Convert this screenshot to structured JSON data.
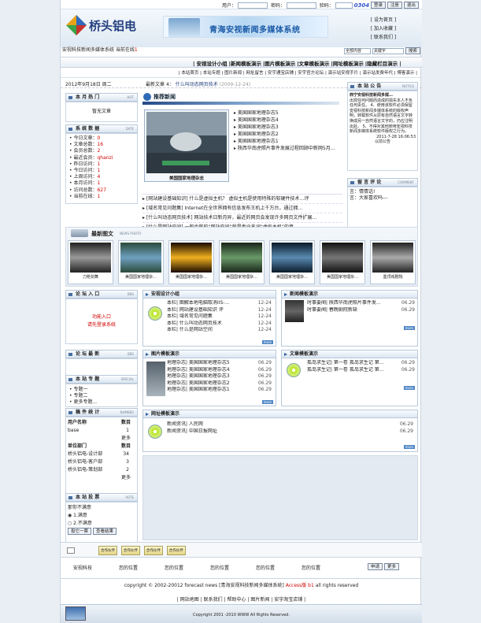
{
  "login": {
    "user_label": "用户：",
    "pass_label": "密码：",
    "code_label": "验码：",
    "code": "0304",
    "btn_login": "登录",
    "btn_register": "注册",
    "btn_logout": "退出"
  },
  "header": {
    "logo_text": "桥头铝电",
    "banner_text": "青海安视新闻多媒体系统",
    "quick": [
      "[ 设为首页 ]",
      "[ 加入收藏 ]",
      "[ 联系我们 ]"
    ],
    "subtitle": "安视科技新闻多媒体系统  当前在线",
    "online": "1"
  },
  "search": {
    "scope": "全部内容",
    "value": "关键字",
    "button": "搜索"
  },
  "nav": [
    "安视设计小组",
    "新闻模板演示",
    "图片模板演示",
    "文章模板演示",
    "网址模板演示",
    "隐藏栏目演示"
  ],
  "nav2": [
    "本站首页",
    "本站专题",
    "图片新闻",
    "网址留言",
    "安宇通宝店铺",
    "安宇官方论坛",
    "演示站安视手片",
    "演示站发费年代",
    "博客演示"
  ],
  "datebar": {
    "date": "2012年9月18日 周二",
    "hot_label": "最新文章",
    "hot_count": "4：",
    "hot_title": "什么叫动态网页技术",
    "hot_date": "(2009-12-24)"
  },
  "month_hot": {
    "title": "本 月 热 门",
    "tag": "HOT",
    "empty": "暂无文章"
  },
  "stats": {
    "title": "系 统 数 据",
    "tag": "DATE",
    "items": [
      {
        "label": "今日文章：",
        "value": "0"
      },
      {
        "label": "文章总数：",
        "value": "16"
      },
      {
        "label": "会员总数：",
        "value": "2"
      },
      {
        "label": "最近会员：",
        "value": "qhanzi"
      },
      {
        "label": "昨日访问：",
        "value": "1"
      },
      {
        "label": "今日访问：",
        "value": "1"
      },
      {
        "label": "上周访问：",
        "value": "4"
      },
      {
        "label": "本月访问：",
        "value": "1"
      },
      {
        "label": "访问总数：",
        "value": "627"
      },
      {
        "label": "当前在线：",
        "value": "1"
      }
    ]
  },
  "recommend": {
    "title": "推荐新闻",
    "caption": "美国国家地理杂志",
    "items": [
      "美国国家地理杂志5",
      "美国国家地理杂志4",
      "美国国家地理杂志3",
      "美国国家地理杂志2",
      "美国国家地理杂志1",
      "陕西华南虎照片事件发展过程回顾中新网5月…"
    ]
  },
  "news_lines": [
    "[网站建设基础知识] 什么是虚拟主机？ 虚拟主机是使用特殊的软硬件技术…评",
    "[域名常见问题集] Internet在全世界拥有信息发布王机上千万台，通过拥…",
    "[什么叫动态网页技术] 网站技术日新月异，最近的网页会发现许多网页文件扩展…",
    "[什么是网站空间] 一般也称的“网站空间”就是专业名词“虚拟主机”的意…"
  ],
  "notice": {
    "title": "本 站 公 告",
    "tag": "NOTICE",
    "heading": "西宁安视科技新闻多媒…",
    "body": "出现任何问题而造成的损失本人不负任何责任。 4、使用该软件必须保留安视科技新闻多媒体系统的版权声明，转载软件从原有自然语言文字转换成另一自然语言文字的，仍应注明出处。 5、不得对其他使用安视科技新闻多媒体系统软件版权之行为。",
    "time": "2011-7-28 16:06:53",
    "more": "以前公告"
  },
  "comments": {
    "title": "留 言 评 论",
    "tag": "COMMENT",
    "items": [
      "言：情情话!",
      "言：大家喜欢吗---"
    ]
  },
  "latest_pics": {
    "title": "最新图文",
    "tag": "NEWS PHOTO",
    "items": [
      "刀枪剑舞",
      "美国国家地理杂…",
      "美国国家地理杂…",
      "美国国家地理杂…",
      "美国国家地理杂…",
      "美国国家地理杂…",
      "墨顶戏剧院"
    ]
  },
  "forum_entry": {
    "title": "论 坛 入 口",
    "tag": "BBS",
    "link1": "功能入口",
    "link2": "请先登录系统"
  },
  "forum_new": {
    "title": "论 坛 最 新",
    "tag": "BBS"
  },
  "topics": {
    "title": "本 站 专 题",
    "tag": "SPECIAL",
    "items": [
      "专题一",
      "专题二",
      "更多专题..."
    ]
  },
  "draft_stats": {
    "title": "稿 件 统 计",
    "tag": "NUMBER",
    "user_header": "用户名称",
    "user_count_header": "数目",
    "users": [
      {
        "name": "base",
        "count": "1"
      }
    ],
    "more": "更多",
    "dept_header": "单位部门",
    "dept_count_header": "数目",
    "depts": [
      {
        "name": "桥头铝电-设计部",
        "count": "34"
      },
      {
        "name": "桥头铝电-客户部",
        "count": "3"
      },
      {
        "name": "桥头铝电-策划部",
        "count": "2"
      }
    ],
    "more2": "更多"
  },
  "vote": {
    "title": "本 站 投 票",
    "tag": "VOTE",
    "question": "那你不满意",
    "opt1": "1.满意",
    "opt2": "2.不满意",
    "btn_vote": "投它一票",
    "btn_result": "查看结果"
  },
  "design_group": {
    "title": "安视设计小组",
    "items": [
      {
        "t": "本栏| 图解本地电脑取消IIS-…",
        "d": "12-24"
      },
      {
        "t": "本栏| 网站建设基础知识 评",
        "d": "12-24"
      },
      {
        "t": "本栏| 域名常见问题集",
        "d": "12-24"
      },
      {
        "t": "本栏| 什么叫动态网页技术",
        "d": "12-24"
      },
      {
        "t": "本栏| 什么是网站空间",
        "d": "12-24"
      }
    ]
  },
  "news_tpl": {
    "title": "新闻模板演示",
    "items": [
      {
        "t": "时事要闻| 陕西华南虎照片事件发…",
        "d": "06.29"
      },
      {
        "t": "时事要闻| 春晚剧院新缺",
        "d": "06.29"
      }
    ]
  },
  "pic_tpl": {
    "title": "图片模板演示",
    "items": [
      {
        "t": "地理杂志| 美国国家地理杂志5",
        "d": "06.29"
      },
      {
        "t": "地理杂志| 美国国家地理杂志4",
        "d": "06.29"
      },
      {
        "t": "地理杂志| 美国国家地理杂志3",
        "d": "06.29"
      },
      {
        "t": "地理杂志| 美国国家地理杂志2",
        "d": "06.29"
      },
      {
        "t": "地理杂志| 美国国家地理杂志1",
        "d": "06.29"
      }
    ]
  },
  "article_tpl": {
    "title": "文章模板演示",
    "items": [
      {
        "t": "孤岛求生记| 第一卷 孤岛求生记 第…",
        "d": "06.29"
      },
      {
        "t": "孤岛求生记| 第一卷 孤岛求生记 第…",
        "d": "06.29"
      }
    ]
  },
  "url_tpl": {
    "title": "网址模板演示",
    "items": [
      {
        "t": "新闻资讯| 人民网",
        "d": "06.29"
      },
      {
        "t": "新闻资讯| 中国日报网址",
        "d": "06.29"
      }
    ]
  },
  "footer_btns": [
    "合作伙伴",
    "合作伙伴",
    "合作伙伴",
    "合作伙伴"
  ],
  "footer_links": [
    "安视科技",
    "您的位置",
    "您的位置",
    "您的位置",
    "您的位置",
    "您的位置"
  ],
  "footer_link_btns": [
    "申请",
    "更多"
  ],
  "copyright": {
    "text": "copyright © 2002-20012 forecast news [青海安视科技新闻多媒体系统]",
    "access": "Access版 b1",
    "rights": "all rights reserved"
  },
  "bottom_links": [
    "网站地图",
    "联系我们",
    "帮助中心",
    "图片新闻",
    "安宇淘宝店铺"
  ],
  "bottom_copyright": "Copyright 2001 -2010 WWW          All Rights Reserved."
}
